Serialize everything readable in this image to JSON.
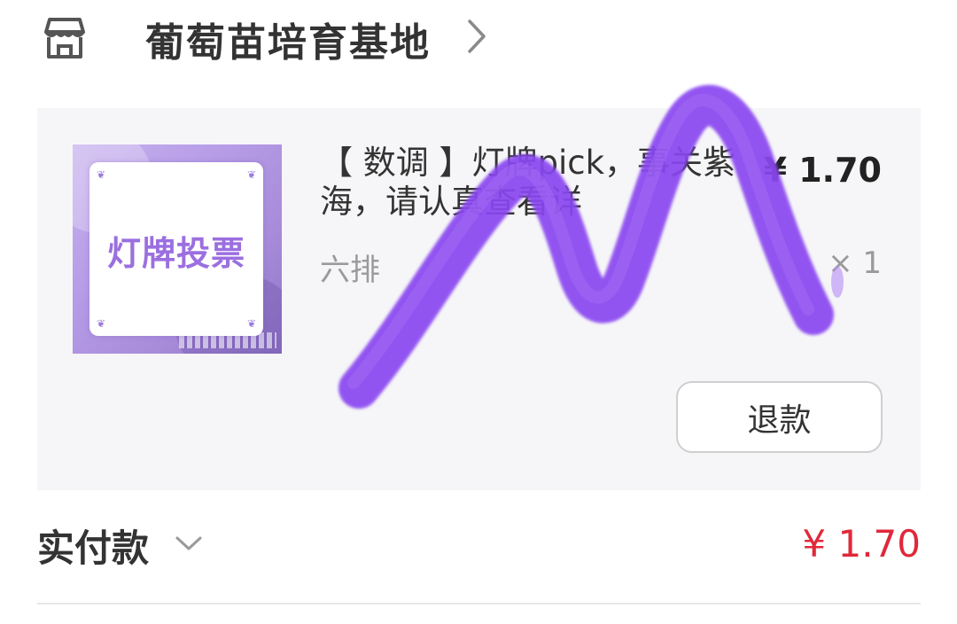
{
  "shop": {
    "name": "葡萄苗培育基地",
    "icon": "store-icon"
  },
  "product": {
    "thumbnail_text": "灯牌投票",
    "title": "【 数调 】灯牌pick，事关紫海，请认真查看详",
    "price": "¥ 1.70",
    "sku": "六排",
    "quantity": "× 1",
    "refund_label": "退款"
  },
  "payment": {
    "label": "实付款",
    "amount": "¥ 1.70",
    "amount_color": "#e0283a"
  },
  "colors": {
    "card_bg": "#f6f6f8",
    "brush": "#8a46f0",
    "thumbnail_text": "#9b6fe0"
  }
}
